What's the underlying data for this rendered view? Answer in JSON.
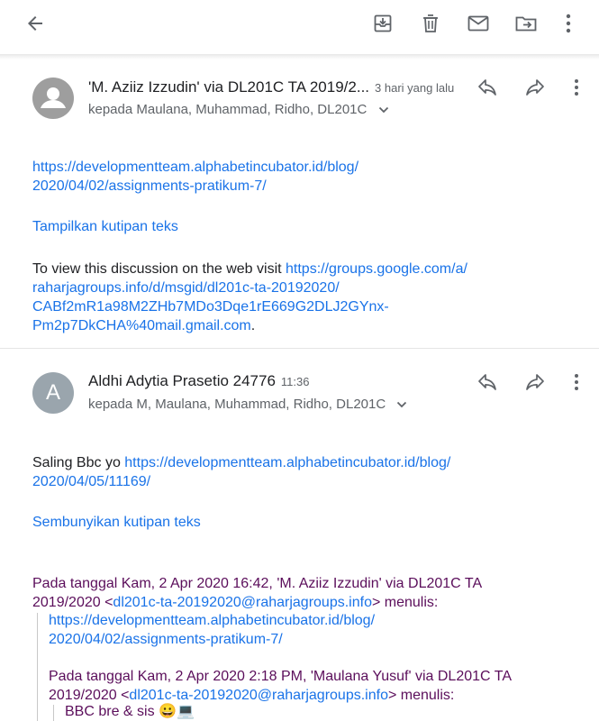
{
  "toolbar": {
    "icons": [
      "back-arrow-icon",
      "archive-icon",
      "delete-icon",
      "mail-icon",
      "move-to-icon",
      "more-vert-icon"
    ]
  },
  "message1": {
    "sender": "'M. Aziiz Izzudin' via DL201C TA 2019/2...",
    "time": "3 hari yang lalu",
    "recipients": "kepada Maulana, Muhammad, Ridho, DL201C",
    "link_line1": "https://developmentteam.alphabetincubator.id/blog/",
    "link_line2": "2020/04/02/assignments-pratikum-7/",
    "show_quote": "Tampilkan kutipan teks",
    "discussion_prefix": "To view this discussion on the web visit ",
    "discussion_link1": "https://groups.google.com/a/",
    "discussion_link2": "raharjagroups.info/d/msgid/dl201c-ta-20192020/",
    "discussion_link3": "CABf2mR1a98M2ZHb7MDo3Dqe1rE669G2DLJ2GYnx-",
    "discussion_link4": "Pm2p7DkCHA%40mail.gmail.com",
    "discussion_suffix": "."
  },
  "message2": {
    "avatar_letter": "A",
    "sender": "Aldhi Adytia Prasetio 24776",
    "time": "11:36",
    "recipients": "kepada M, Maulana, Muhammad, Ridho, DL201C",
    "body_prefix": "Saling Bbc yo ",
    "body_link1": "https://developmentteam.alphabetincubator.id/blog/",
    "body_link2": "2020/04/05/11169/",
    "hide_quote": "Sembunyikan kutipan teks",
    "q1_line1": "Pada tanggal Kam, 2 Apr 2020 16:42, 'M. Aziiz Izzudin' via DL201C TA",
    "q1_line2_prefix": "2019/2020 <",
    "q1_email": "dl201c-ta-20192020@raharjagroups.info",
    "q1_line2_suffix": "> menulis:",
    "q1_link1": "https://developmentteam.alphabetincubator.id/blog/",
    "q1_link2": "2020/04/02/assignments-pratikum-7/",
    "q2_line1": "Pada tanggal Kam, 2 Apr 2020 2:18 PM, 'Maulana Yusuf' via DL201C TA",
    "q2_line2_prefix": "2019/2020 <",
    "q2_email": "dl201c-ta-20192020@raharjagroups.info",
    "q2_line2_suffix": "> menulis:",
    "q2_text": "BBC bre & sis 😀💻"
  },
  "colors": {
    "link": "#1a73e8",
    "quote": "#5b0e5b",
    "avatar2": "#9aa5ad",
    "avatar1": "#9e9e9e"
  }
}
